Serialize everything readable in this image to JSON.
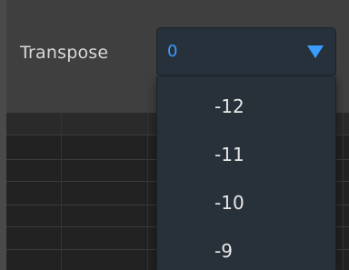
{
  "toolbar": {
    "transpose_label": "Transpose",
    "transpose_value": "0"
  },
  "dropdown": {
    "options": [
      "-12",
      "-11",
      "-10",
      "-9"
    ]
  },
  "colors": {
    "accent": "#3b9cff",
    "dropdown_bg": "#283039",
    "select_bg": "#26313b",
    "panel_bg": "#3f3f3f",
    "grid_bg": "#222222"
  },
  "icons": {
    "select_arrow": "chevron-down-icon"
  }
}
